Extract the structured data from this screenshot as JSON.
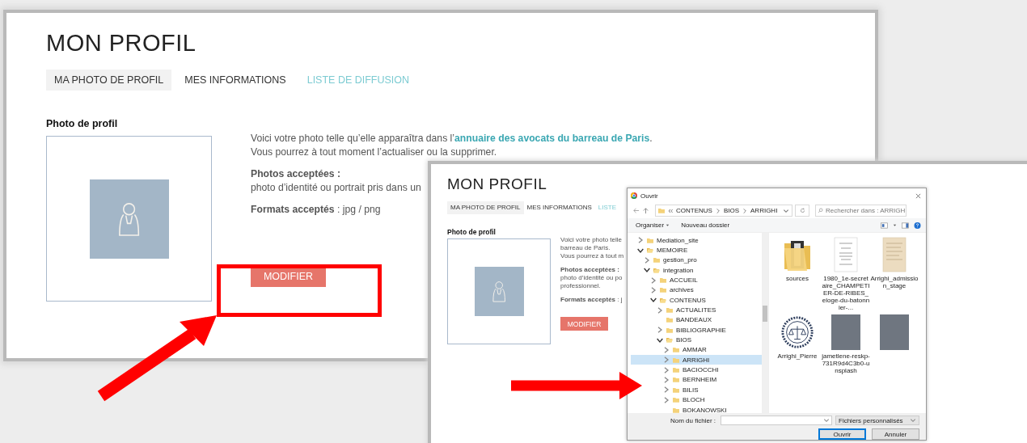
{
  "panels": [
    {
      "title": "MON PROFIL",
      "tabs": [
        {
          "label": "MA PHOTO DE PROFIL",
          "kind": "tab",
          "selected": true
        },
        {
          "label": "MES INFORMATIONS",
          "kind": "tab",
          "selected": false
        },
        {
          "label": "LISTE DE DIFFUSION",
          "kind": "link",
          "selected": false
        }
      ],
      "section_title": "Photo de profil",
      "intro": [
        {
          "text": "Voici votre photo telle qu’elle apparaîtra dans l’",
          "link": "annuaire des avocats du barreau de Paris",
          "after": "."
        },
        {
          "text": "Vous pourrez à tout moment l’actualiser ou la supprimer."
        }
      ],
      "accepted": {
        "heading": "Photos acceptées :",
        "lines": [
          "photo d’identité ou portrait pris dans un"
        ]
      },
      "formats": {
        "heading": "Formats acceptés",
        "value": " : jpg / png"
      },
      "button": "MODIFIER"
    },
    {
      "title": "MON PROFIL",
      "tabs": [
        {
          "label": "MA PHOTO DE PROFIL",
          "kind": "tab",
          "selected": true
        },
        {
          "label": "MES INFORMATIONS",
          "kind": "tab",
          "selected": false
        },
        {
          "label": "LISTE",
          "kind": "link",
          "selected": false
        }
      ],
      "section_title": "Photo de profil",
      "intro": [
        {
          "text": "Voici votre photo telle"
        },
        {
          "text": "barreau de Paris."
        },
        {
          "text": "Vous pourrez à tout m"
        }
      ],
      "accepted": {
        "heading": "Photos acceptées :",
        "lines": [
          "photo d’identité ou po",
          "professionnel."
        ]
      },
      "formats": {
        "heading": "Formats acceptés",
        "value": " : j"
      },
      "button": "MODIFIER"
    }
  ],
  "dialog": {
    "title": "Ouvrir",
    "path": [
      "CONTENUS",
      "BIOS",
      "ARRIGHI"
    ],
    "search": {
      "placeholder": "Rechercher dans : ARRIGHI"
    },
    "toolbar": [
      {
        "label": "Organiser",
        "kind": "menu"
      },
      {
        "label": "Nouveau dossier",
        "kind": "action"
      }
    ],
    "tree": [
      {
        "name": "Mediation_site",
        "expandable": true,
        "expanded": false,
        "selected": false
      },
      {
        "name": "MEMOIRE",
        "expandable": true,
        "expanded": true,
        "selected": false,
        "children": [
          {
            "name": "gestion_pro",
            "expandable": true,
            "expanded": false,
            "selected": false
          },
          {
            "name": "integration",
            "expandable": true,
            "expanded": true,
            "selected": false,
            "children": [
              {
                "name": "ACCUEIL",
                "expandable": true,
                "expanded": false,
                "selected": false
              },
              {
                "name": "archives",
                "expandable": true,
                "expanded": false,
                "selected": false
              },
              {
                "name": "CONTENUS",
                "expandable": true,
                "expanded": true,
                "selected": false,
                "children": [
                  {
                    "name": "ACTUALITES",
                    "expandable": true,
                    "expanded": false,
                    "selected": false
                  },
                  {
                    "name": "BANDEAUX",
                    "expandable": false,
                    "expanded": false,
                    "selected": false
                  },
                  {
                    "name": "BIBLIOGRAPHIE",
                    "expandable": true,
                    "expanded": false,
                    "selected": false
                  },
                  {
                    "name": "BIOS",
                    "expandable": true,
                    "expanded": true,
                    "selected": false,
                    "children": [
                      {
                        "name": "AMMAR",
                        "expandable": true,
                        "expanded": false,
                        "selected": false
                      },
                      {
                        "name": "ARRIGHI",
                        "expandable": true,
                        "expanded": false,
                        "selected": true
                      },
                      {
                        "name": "BACIOCCHI",
                        "expandable": true,
                        "expanded": false,
                        "selected": false
                      },
                      {
                        "name": "BERNHEIM",
                        "expandable": true,
                        "expanded": false,
                        "selected": false
                      },
                      {
                        "name": "BILIS",
                        "expandable": true,
                        "expanded": false,
                        "selected": false
                      },
                      {
                        "name": "BLOCH",
                        "expandable": true,
                        "expanded": false,
                        "selected": false
                      },
                      {
                        "name": "BOKANOWSKI",
                        "expandable": false,
                        "expanded": false,
                        "selected": false
                      }
                    ]
                  }
                ]
              }
            ]
          }
        ]
      }
    ],
    "files": [
      {
        "name": "sources",
        "kind": "folder"
      },
      {
        "name": "1980_1e-secretaire_CHAMPETIER-DE-RIBES_eloge-du-batonnier-...",
        "kind": "document"
      },
      {
        "name": "Arrighi_admission_stage",
        "kind": "old-document"
      },
      {
        "name": "Arrighi_Pierre",
        "kind": "emblem"
      },
      {
        "name": "jametlene-reskp-731R9d4C3b0-unsplash",
        "kind": "photo"
      },
      {
        "kind": "photo"
      }
    ],
    "filename": {
      "label": "Nom du fichier :"
    },
    "filter": "Fichiers personnalisés",
    "buttons": [
      {
        "label": "Ouvrir",
        "kind": "primary"
      },
      {
        "label": "Annuler",
        "kind": "secondary"
      }
    ]
  }
}
